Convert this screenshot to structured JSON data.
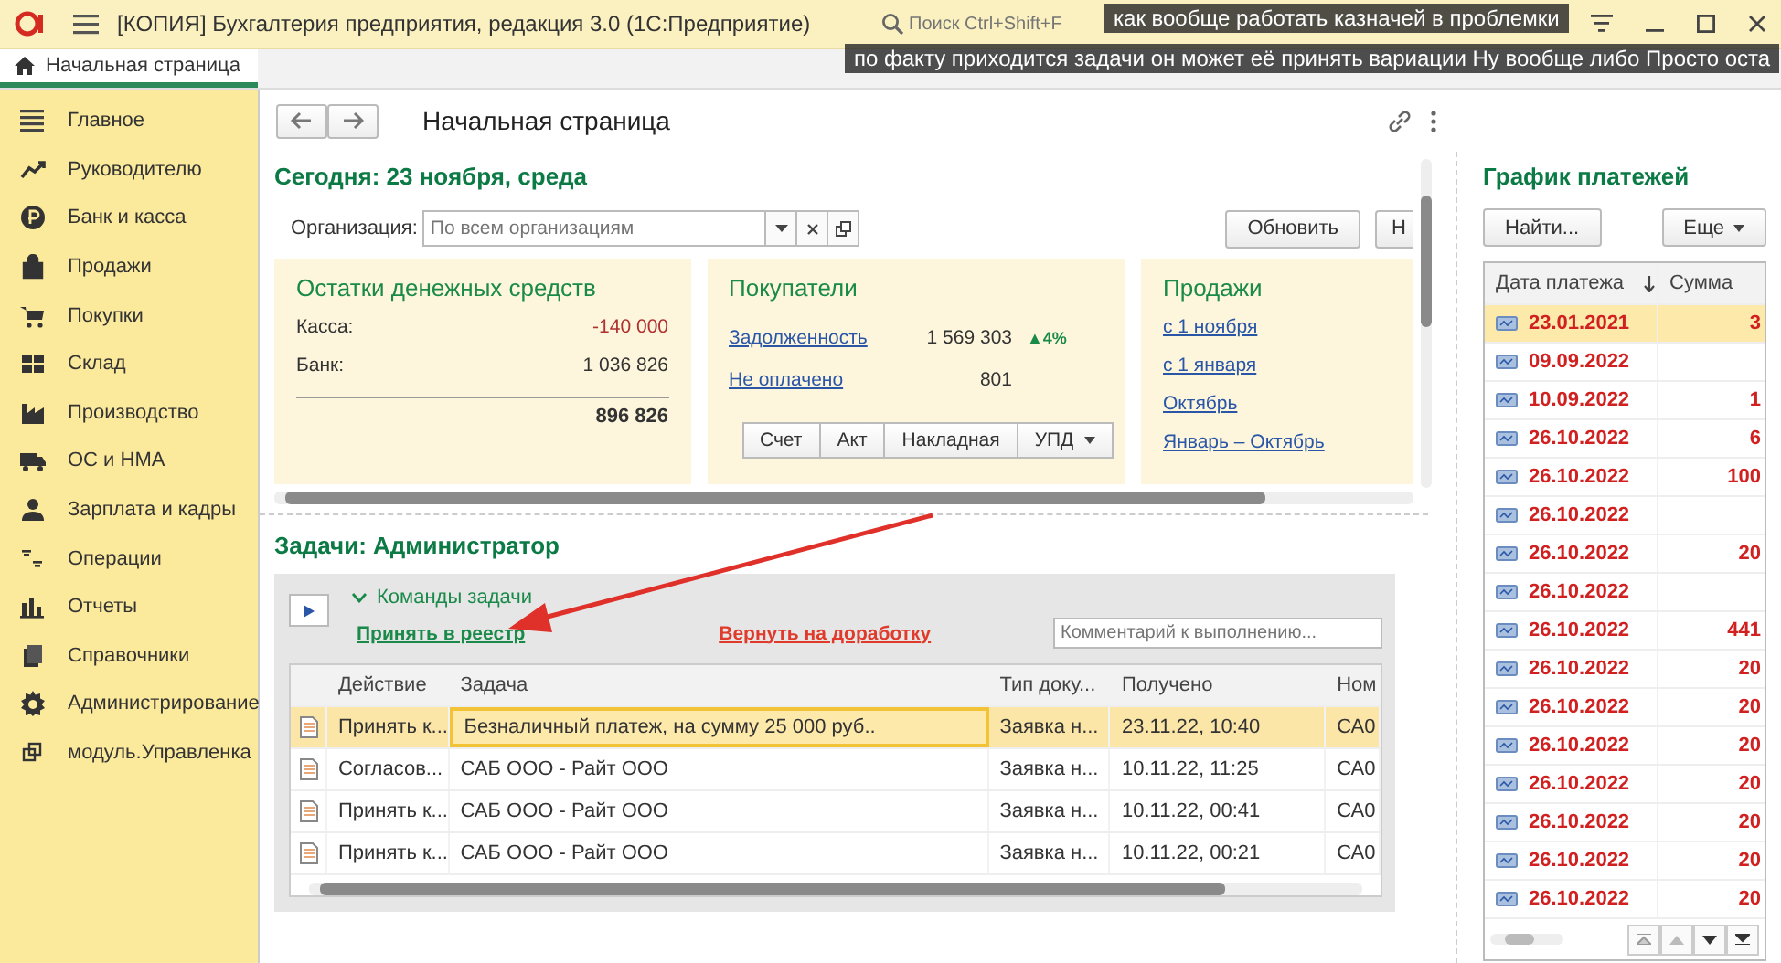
{
  "window": {
    "title": "[КОПИЯ] Бухгалтерия предприятия, редакция 3.0  (1С:Предприятие)",
    "search_placeholder": "Поиск Ctrl+Shift+F"
  },
  "captions": [
    "как вообще работать казначей в проблемки",
    "по факту приходится задачи он может её принять вариации Ну вообще либо Просто оста"
  ],
  "tabs": [
    {
      "label": "Начальная страница",
      "selected": true
    }
  ],
  "sidebar": {
    "items": [
      {
        "label": "Главное"
      },
      {
        "label": "Руководителю"
      },
      {
        "label": "Банк и касса"
      },
      {
        "label": "Продажи"
      },
      {
        "label": "Покупки"
      },
      {
        "label": "Склад"
      },
      {
        "label": "Производство"
      },
      {
        "label": "ОС и НМА"
      },
      {
        "label": "Зарплата и кадры"
      },
      {
        "label": "Операции"
      },
      {
        "label": "Отчеты"
      },
      {
        "label": "Справочники"
      },
      {
        "label": "Администрирование"
      },
      {
        "label": "модуль.Управленка"
      }
    ]
  },
  "page": {
    "title": "Начальная страница",
    "today": "Сегодня: 23 ноября, среда",
    "org_label": "Организация:",
    "org_placeholder": "По всем организациям",
    "refresh": "Обновить",
    "next_button": "Н"
  },
  "cash": {
    "title": "Остатки денежных средств",
    "rows": [
      {
        "label": "Касса:",
        "value": "-140 000",
        "negative": true
      },
      {
        "label": "Банк:",
        "value": "1 036 826",
        "negative": false
      }
    ],
    "total": "896 826"
  },
  "buyers": {
    "title": "Покупатели",
    "rows": [
      {
        "label": "Задолженность",
        "value": "1 569 303",
        "trend": "▲4%"
      },
      {
        "label": "Не оплачено",
        "value": "801"
      }
    ],
    "buttons": [
      "Счет",
      "Акт",
      "Накладная",
      "УПД"
    ]
  },
  "sales": {
    "title": "Продажи",
    "links": [
      "с 1 ноября",
      "с 1 января",
      "Октябрь",
      "Январь – Октябрь"
    ]
  },
  "tasks": {
    "title": "Задачи: Администратор",
    "commands": "Команды задачи",
    "accept": "Принять в реестр",
    "return": "Вернуть на доработку",
    "comment_placeholder": "Комментарий к выполнению...",
    "columns": [
      "Действие",
      "Задача",
      "Тип доку...",
      "Получено",
      "Ном"
    ],
    "rows": [
      {
        "action": "Принять к...",
        "task": "Безналичный платеж,  на сумму 25 000 руб..",
        "type": "Заявка н...",
        "received": "23.11.22, 10:40",
        "number": "СА0",
        "selected": true
      },
      {
        "action": "Согласов...",
        "task": "САБ ООО - Райт ООО",
        "type": "Заявка н...",
        "received": "10.11.22, 11:25",
        "number": "СА0",
        "selected": false
      },
      {
        "action": "Принять к...",
        "task": "САБ ООО - Райт ООО",
        "type": "Заявка н...",
        "received": "10.11.22, 00:41",
        "number": "СА0",
        "selected": false
      },
      {
        "action": "Принять к...",
        "task": "САБ ООО - Райт ООО",
        "type": "Заявка н...",
        "received": "10.11.22, 00:21",
        "number": "СА0",
        "selected": false
      }
    ]
  },
  "payments": {
    "title": "График платежей",
    "find": "Найти...",
    "more": "Еще",
    "columns": [
      "Дата платежа",
      "Сумма"
    ],
    "rows": [
      {
        "date": "23.01.2021",
        "sum": "3",
        "selected": true
      },
      {
        "date": "09.09.2022",
        "selected": false
      },
      {
        "date": "10.09.2022",
        "sum": "1",
        "selected": false
      },
      {
        "date": "26.10.2022",
        "sum": "6",
        "selected": false
      },
      {
        "date": "26.10.2022",
        "sum": "100",
        "selected": false
      },
      {
        "date": "26.10.2022",
        "selected": false
      },
      {
        "date": "26.10.2022",
        "sum": "20",
        "selected": false
      },
      {
        "date": "26.10.2022",
        "selected": false
      },
      {
        "date": "26.10.2022",
        "sum": "441",
        "selected": false
      },
      {
        "date": "26.10.2022",
        "sum": "20",
        "selected": false
      },
      {
        "date": "26.10.2022",
        "sum": "20",
        "selected": false
      },
      {
        "date": "26.10.2022",
        "sum": "20",
        "selected": false
      },
      {
        "date": "26.10.2022",
        "sum": "20",
        "selected": false
      },
      {
        "date": "26.10.2022",
        "sum": "20",
        "selected": false
      },
      {
        "date": "26.10.2022",
        "sum": "20",
        "selected": false
      },
      {
        "date": "26.10.2022",
        "sum": "20",
        "selected": false
      }
    ]
  }
}
